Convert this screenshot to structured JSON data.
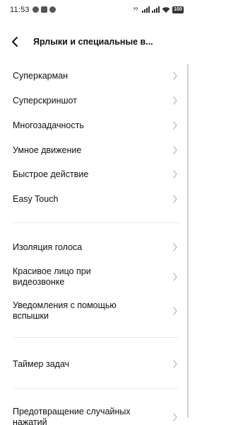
{
  "status_bar": {
    "time": "11:53",
    "net_speed": "??",
    "battery": "100",
    "notification_icons": [
      "message-icon",
      "app-notification-icon",
      "alarm-icon"
    ]
  },
  "header": {
    "title": "Ярлыки и специальные в..."
  },
  "items": [
    {
      "label": "Суперкарман"
    },
    {
      "label": "Суперскриншот"
    },
    {
      "label": "Многозадачность"
    },
    {
      "label": "Умное движение"
    },
    {
      "label": "Быстрое действие"
    },
    {
      "label": "Easy Touch"
    },
    {
      "label": "Изоляция голоса"
    },
    {
      "label": "Красивое лицо при видеозвонке"
    },
    {
      "label": "Уведомления с помощью вспышки"
    },
    {
      "label": "Таймер задач"
    },
    {
      "label": "Предотвращение случайных нажатий"
    }
  ],
  "colors": {
    "accent_text": "#111111",
    "chevron": "#bbbbbb",
    "divider": "#e8e8e8"
  }
}
